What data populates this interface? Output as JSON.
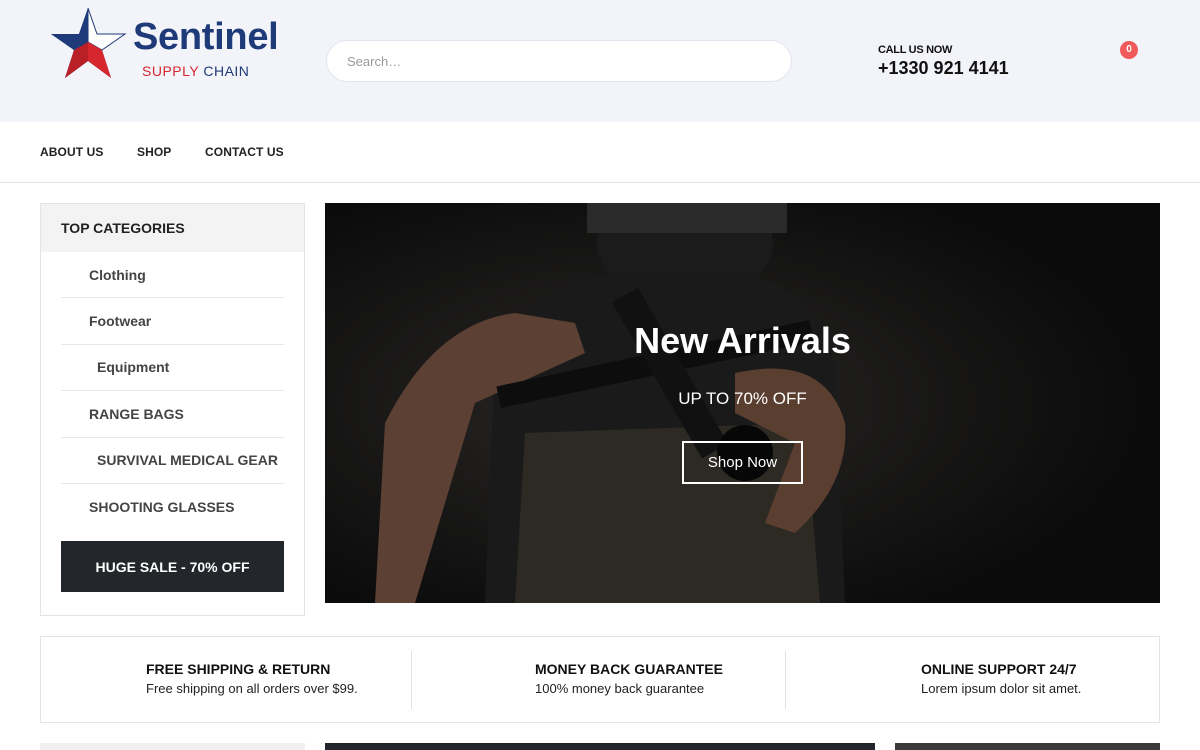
{
  "brand": {
    "name": "Sentinel",
    "tagline_red": "SUPPLY",
    "tagline_blue": "CHAIN",
    "colors": {
      "navy": "#1e3a78",
      "red": "#d6262e"
    }
  },
  "header": {
    "search": {
      "placeholder": "Search…",
      "value": ""
    },
    "call_label": "CALL US NOW",
    "phone": "+1330 921 4141",
    "cart": {
      "icon": "cart-icon",
      "count": "0",
      "badge_color": "#f05a5a"
    }
  },
  "nav": {
    "items": [
      {
        "label": "ABOUT US"
      },
      {
        "label": "SHOP"
      },
      {
        "label": "CONTACT US"
      }
    ]
  },
  "sidebar": {
    "title": "TOP CATEGORIES",
    "categories": [
      {
        "label": "Clothing"
      },
      {
        "label": "Footwear"
      },
      {
        "label": "Equipment"
      },
      {
        "label": "RANGE BAGS"
      },
      {
        "label": "SURVIVAL MEDICAL GEAR"
      },
      {
        "label": "SHOOTING GLASSES"
      }
    ],
    "sale_button": "HUGE SALE - 70% OFF"
  },
  "hero": {
    "title": "New Arrivals",
    "subtitle": "UP TO 70% OFF",
    "button": "Shop Now"
  },
  "features": [
    {
      "icon": "truck-icon",
      "title": "FREE SHIPPING & RETURN",
      "desc": "Free shipping on all orders over $99."
    },
    {
      "icon": "dollar-icon",
      "title": "MONEY BACK GUARANTEE",
      "desc": "100% money back guarantee"
    },
    {
      "icon": "support-icon",
      "title": "ONLINE SUPPORT 24/7",
      "desc": "Lorem ipsum dolor sit amet."
    }
  ]
}
